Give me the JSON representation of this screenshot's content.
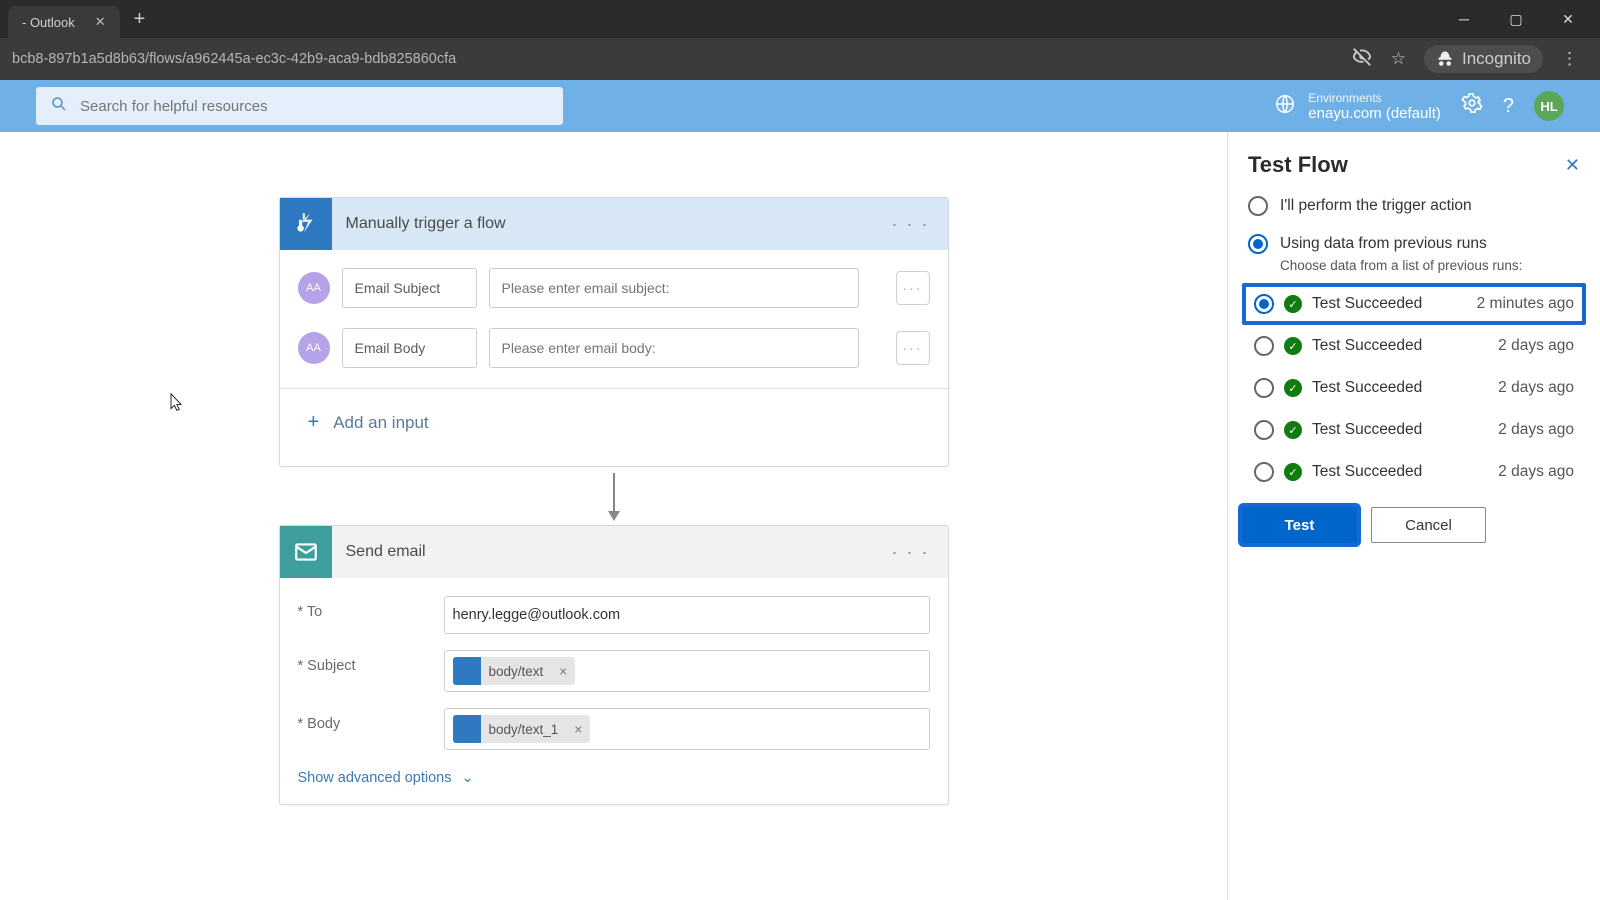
{
  "browser": {
    "tab_title": " - Outlook",
    "url": "bcb8-897b1a5d8b63/flows/a962445a-ec3c-42b9-aca9-bdb825860cfa",
    "incognito_label": "Incognito"
  },
  "header": {
    "search_placeholder": "Search for helpful resources",
    "env_label": "Environments",
    "env_value": "enayu.com (default)",
    "avatar": "HL"
  },
  "trigger_card": {
    "title": "Manually trigger a flow",
    "rows": [
      {
        "label": "Email Subject",
        "placeholder": "Please enter email subject:"
      },
      {
        "label": "Email Body",
        "placeholder": "Please enter email body:"
      }
    ],
    "add_input": "Add an input"
  },
  "email_card": {
    "title": "Send email",
    "to_label": "* To",
    "to_value": "henry.legge@outlook.com",
    "subject_label": "* Subject",
    "subject_token": "body/text",
    "body_label": "* Body",
    "body_token": "body/text_1",
    "advanced": "Show advanced options"
  },
  "panel": {
    "title": "Test Flow",
    "opt_manual": "I'll perform the trigger action",
    "opt_prev": "Using data from previous runs",
    "sub_note": "Choose data from a list of previous runs:",
    "runs": [
      {
        "status": "Test Succeeded",
        "time": "2 minutes ago",
        "selected": true,
        "highlight": true
      },
      {
        "status": "Test Succeeded",
        "time": "2 days ago",
        "selected": false,
        "highlight": false
      },
      {
        "status": "Test Succeeded",
        "time": "2 days ago",
        "selected": false,
        "highlight": false
      },
      {
        "status": "Test Succeeded",
        "time": "2 days ago",
        "selected": false,
        "highlight": false
      },
      {
        "status": "Test Succeeded",
        "time": "2 days ago",
        "selected": false,
        "highlight": false
      }
    ],
    "test_btn": "Test",
    "cancel_btn": "Cancel"
  }
}
